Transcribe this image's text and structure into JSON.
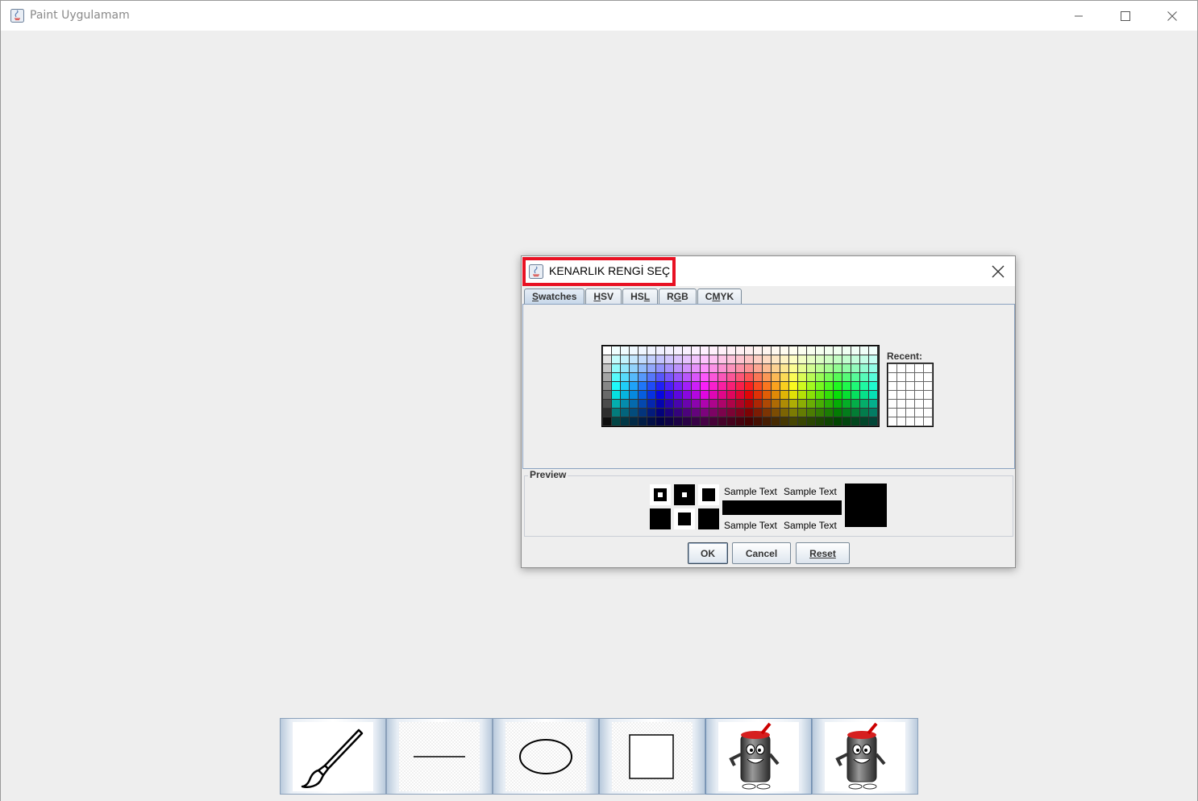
{
  "window": {
    "title": "Paint Uygulamam",
    "controls": [
      "minimize",
      "maximize",
      "close"
    ]
  },
  "dialog": {
    "title": "KENARLIK RENGİ SEÇ",
    "tabs": [
      {
        "label": "Swatches",
        "mnemonic": "S",
        "active": true
      },
      {
        "label": "HSV",
        "mnemonic": "H",
        "active": false
      },
      {
        "label": "HSL",
        "mnemonic": "L",
        "active": false
      },
      {
        "label": "RGB",
        "mnemonic": "G",
        "active": false
      },
      {
        "label": "CMYK",
        "mnemonic": "M",
        "active": false
      }
    ],
    "recent_label": "Recent:",
    "preview": {
      "label": "Preview",
      "sample_text": "Sample Text",
      "color": "#000000"
    },
    "buttons": {
      "ok": "OK",
      "cancel": "Cancel",
      "reset": "Reset"
    },
    "highlight_color": "#e81123"
  },
  "toolbar": {
    "tools": [
      {
        "name": "brush",
        "icon": "paintbrush-icon"
      },
      {
        "name": "line",
        "icon": "line-icon"
      },
      {
        "name": "oval",
        "icon": "ellipse-icon"
      },
      {
        "name": "rectangle",
        "icon": "rectangle-icon"
      },
      {
        "name": "border-color",
        "icon": "paint-can-mascot-icon"
      },
      {
        "name": "fill-color",
        "icon": "paint-can-mascot-icon"
      }
    ]
  }
}
